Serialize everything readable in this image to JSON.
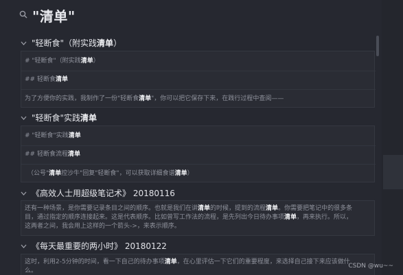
{
  "search": {
    "query": "\"清单\""
  },
  "groups": [
    {
      "title_pre": "\"轻断食\"（附实践",
      "title_hl": "清单",
      "title_post": "）",
      "snippets": [
        {
          "pre": "# \"轻断食\"（附实践",
          "hl": "清单",
          "post": "）"
        },
        {
          "pre": "## 轻断食",
          "hl": "清单",
          "post": ""
        },
        {
          "pre": "为了方便你的实践，我制作了一份\"轻断食",
          "hl": "清单",
          "post": "\"，你可以把它保存下来，在践行过程中查阅——"
        }
      ]
    },
    {
      "title_pre": "\"轻断食\"实践",
      "title_hl": "清单",
      "title_post": "",
      "snippets": [
        {
          "pre": "# \"轻断食\"实践",
          "hl": "清单",
          "post": ""
        },
        {
          "pre": "## 轻断食流程",
          "hl": "清单",
          "post": ""
        },
        {
          "pre": "（公号\"",
          "hl": "清单",
          "post": "控沙牛\"回复\"轻断食\"，可以获取详细食谱",
          "hl2": "清单",
          "post2": "）"
        }
      ]
    },
    {
      "title_pre": "《高效人士用超级笔记术》 20180116",
      "title_hl": "",
      "title_post": "",
      "para": {
        "l1_pre": "还有一种场景，是你需要记录条目之间的顺序。也就是我们在讲",
        "l1_hl": "清单",
        "l1_mid": "的时候，提到的流程",
        "l1_hl2": "清单",
        "l1_post": "。你需要把笔记中的很多条",
        "l2_pre": "目，通过指定的顺序连接起来。这是代表顺序。比如曾写工作法的流程，是先列出今日待办事项",
        "l2_hl": "清单",
        "l2_post": "，再来执行。所以，",
        "l3": "这两者之间，我会用上这样的一个箭头->，来表示顺序。"
      }
    },
    {
      "title_pre": "《每天最重要的两小时》 20180122",
      "title_hl": "",
      "title_post": "",
      "para": {
        "l1_pre": "这时，利用2-5分钟的时间，看一下自己的待办事项",
        "l1_hl": "清单",
        "l1_mid": "，在心里评估一下它们的重要程度，来选择自己接下来应该做什",
        "l1_hl2": "",
        "l1_post": "",
        "l2_pre": "么。",
        "l2_hl": "",
        "l2_post": "",
        "l3": ""
      }
    }
  ],
  "watermark": "CSDN @wu~~"
}
